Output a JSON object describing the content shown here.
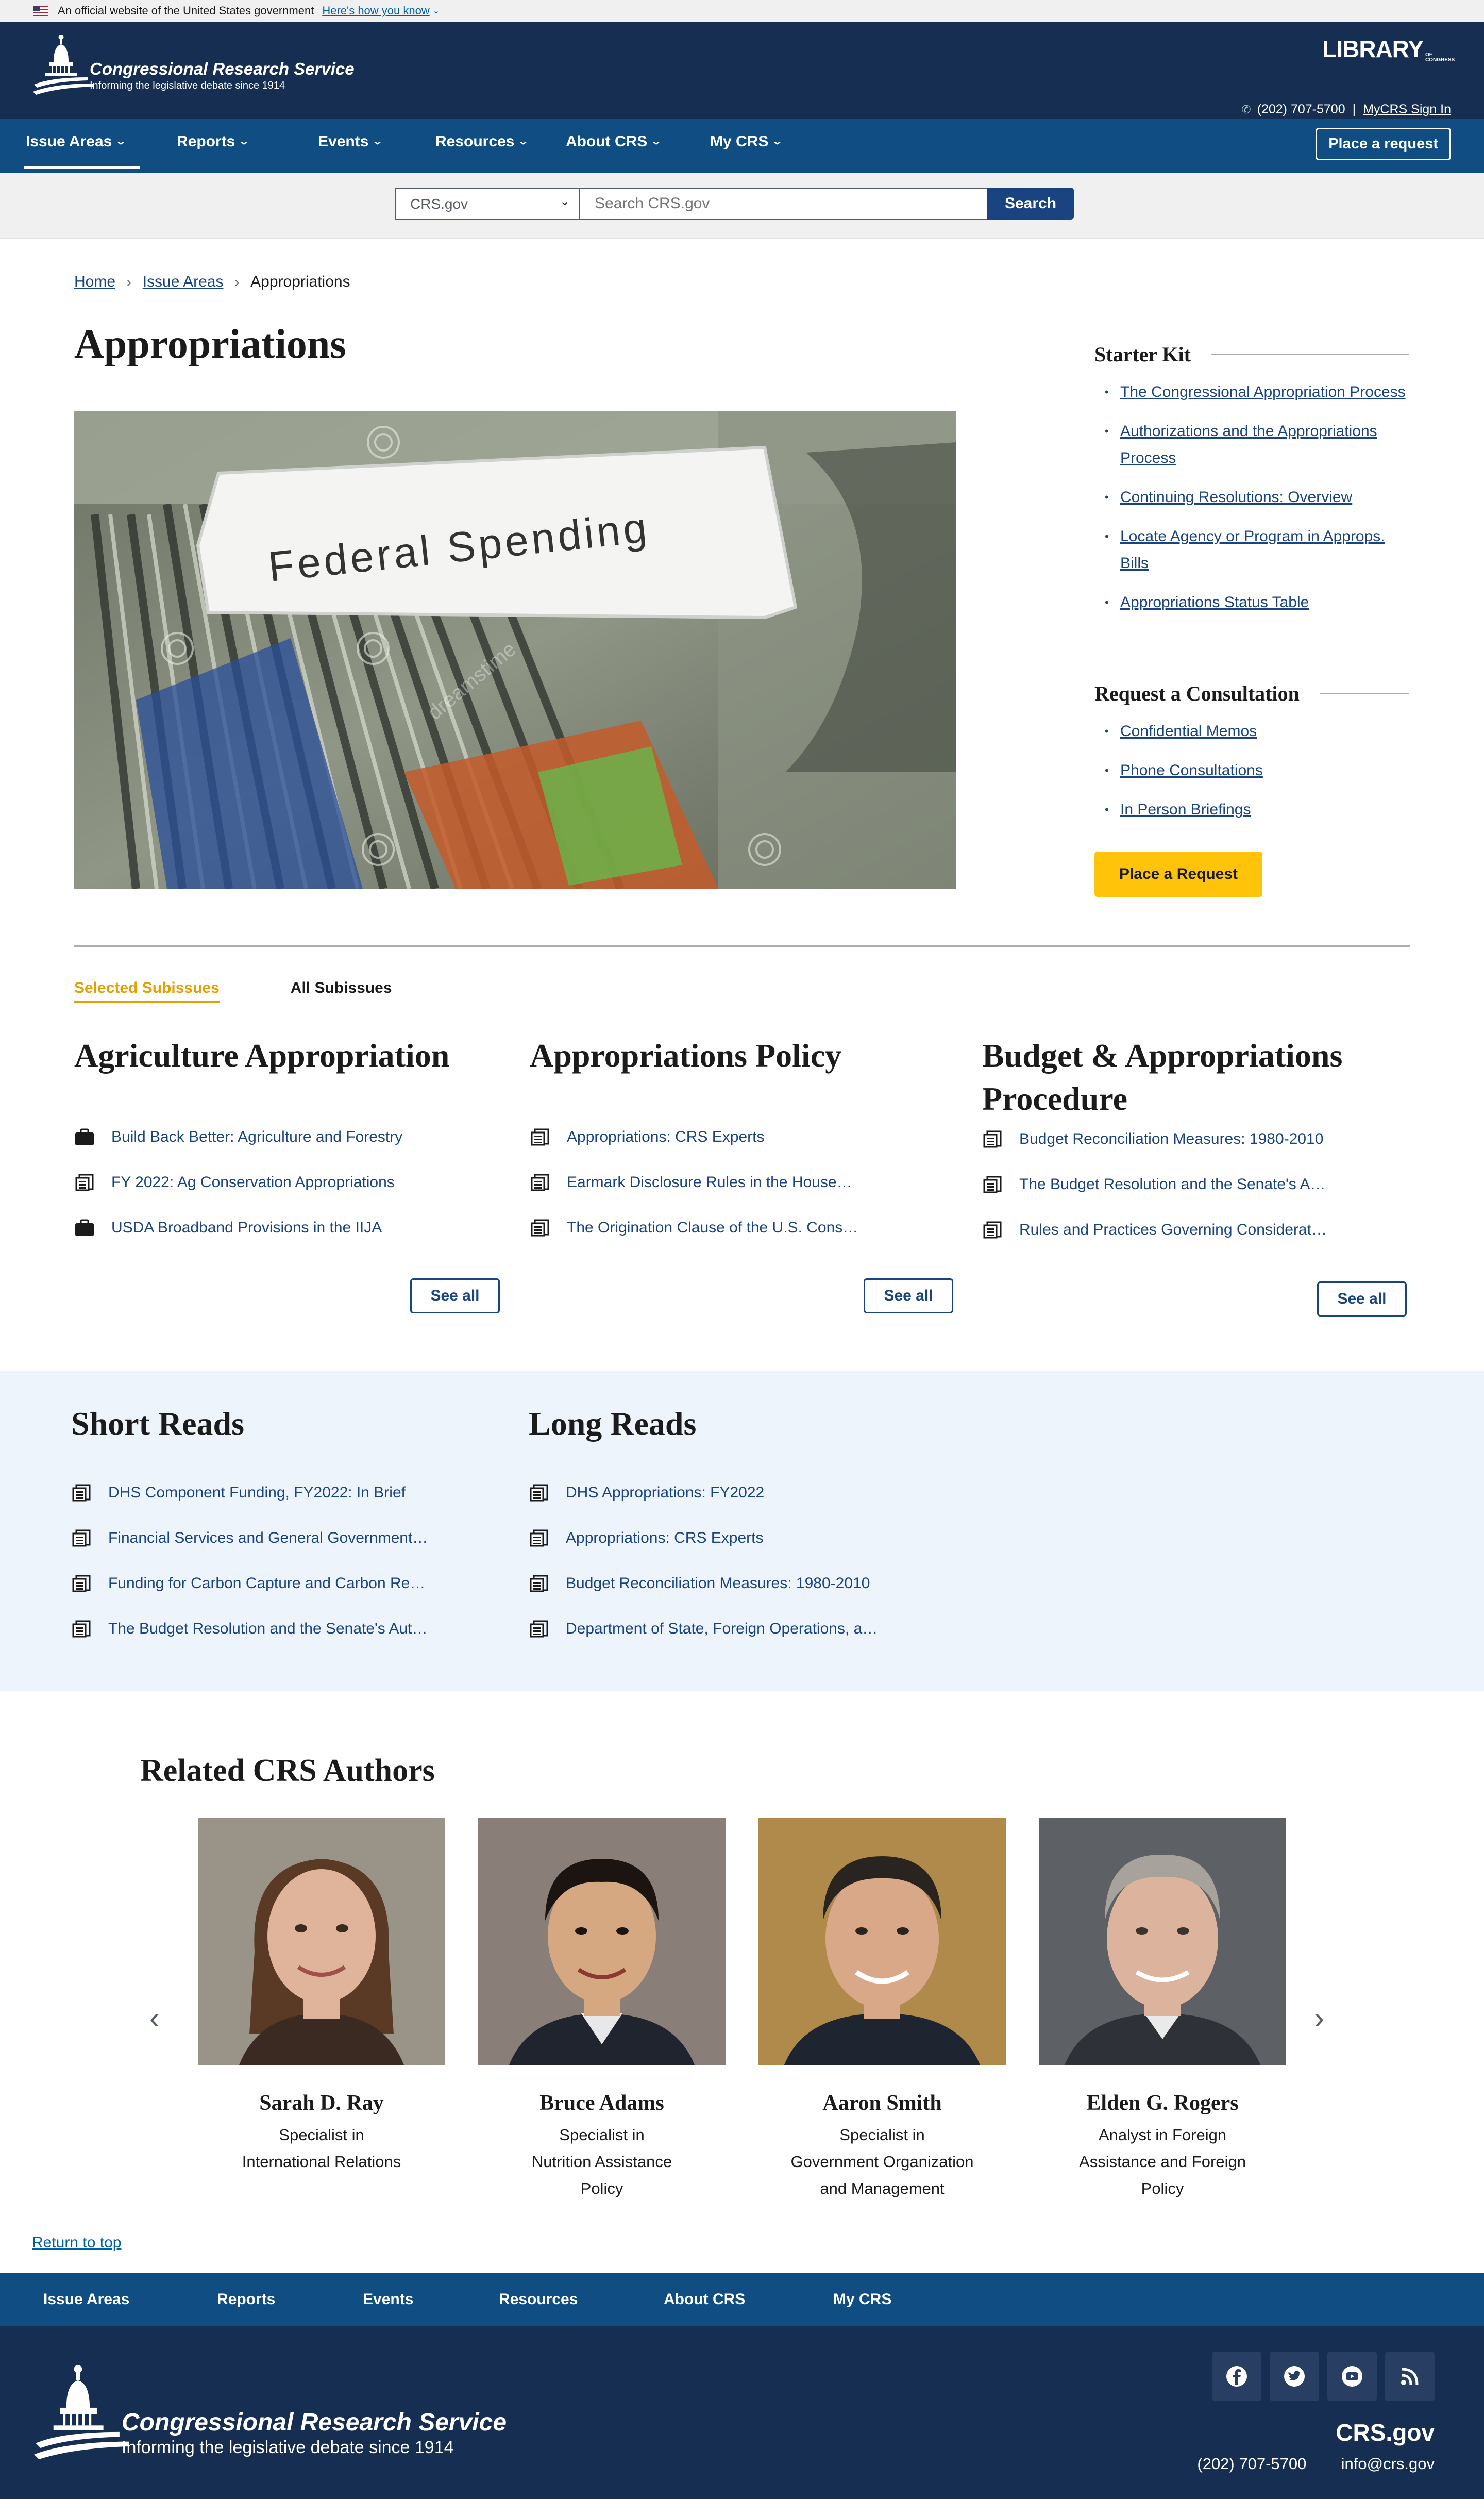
{
  "gov_banner": {
    "text": "An official website of the United States government",
    "link": "Here's how you know"
  },
  "header": {
    "brand_name": "Congressional Research Service",
    "brand_tagline": "Informing the legislative debate since 1914",
    "library_logo": "LIBRARY",
    "library_logo_small": "OF CONGRESS",
    "phone": "(202) 707-5700",
    "separator": "|",
    "sign_in": "MyCRS Sign In"
  },
  "nav": {
    "items": [
      "Issue Areas",
      "Reports",
      "Events",
      "Resources",
      "About CRS",
      "My CRS"
    ],
    "active": "Issue Areas",
    "request_button": "Place a request"
  },
  "search": {
    "scope": "CRS.gov",
    "placeholder": "Search CRS.gov",
    "button": "Search"
  },
  "breadcrumb": {
    "home": "Home",
    "issue_areas": "Issue Areas",
    "current": "Appropriations"
  },
  "page": {
    "title": "Appropriations",
    "hero_text": "Federal Spending",
    "hero_watermark": "dreamstime"
  },
  "starter_kit": {
    "title": "Starter Kit",
    "links": [
      "The Congressional Appropriation Process",
      "Authorizations and the Appropriations Process",
      "Continuing Resolutions: Overview",
      "Locate Agency or Program in Approps. Bills",
      "Appropriations Status Table"
    ]
  },
  "consultation": {
    "title": "Request a Consultation",
    "links": [
      "Confidential Memos",
      "Phone Consultations",
      "In Person Briefings"
    ],
    "button": "Place a Request"
  },
  "subissues": {
    "tabs": [
      "Selected Subissues",
      "All Subissues"
    ],
    "selected_tab": "Selected Subissues",
    "columns": [
      {
        "title": "Agriculture Appropriation",
        "items": [
          {
            "icon": "briefcase-icon",
            "text": "Build Back Better: Agriculture and Forestry"
          },
          {
            "icon": "document-icon",
            "text": "FY 2022: Ag Conservation Appropriations"
          },
          {
            "icon": "briefcase-icon",
            "text": "USDA Broadband Provisions in the IIJA"
          }
        ],
        "see_all": "See all"
      },
      {
        "title": "Appropriations Policy",
        "items": [
          {
            "icon": "document-icon",
            "text": "Appropriations: CRS Experts"
          },
          {
            "icon": "document-icon",
            "text": "Earmark Disclosure Rules in the House…"
          },
          {
            "icon": "document-icon",
            "text": "The Origination Clause of the U.S. Cons…"
          }
        ],
        "see_all": "See all"
      },
      {
        "title": "Budget & Appropriations Procedure",
        "items": [
          {
            "icon": "document-icon",
            "text": "Budget Reconciliation Measures: 1980-2010"
          },
          {
            "icon": "document-icon",
            "text": "The Budget Resolution and the Senate's A…"
          },
          {
            "icon": "document-icon",
            "text": "Rules and Practices Governing Considerat…"
          }
        ],
        "see_all": "See all"
      }
    ]
  },
  "reads": {
    "short": {
      "title": "Short Reads",
      "items": [
        "DHS Component Funding, FY2022: In Brief",
        "Financial Services and General Government…",
        "Funding for Carbon Capture and Carbon Re…",
        "The Budget Resolution and the Senate's Aut…"
      ]
    },
    "long": {
      "title": "Long Reads",
      "items": [
        "DHS Appropriations: FY2022",
        "Appropriations: CRS Experts",
        "Budget Reconciliation Measures: 1980-2010",
        "Department of State, Foreign Operations, a…"
      ]
    }
  },
  "authors": {
    "title": "Related CRS Authors",
    "people": [
      {
        "name": "Sarah D. Ray",
        "role": "Specialist in\nInternational Relations"
      },
      {
        "name": "Bruce Adams",
        "role": "Specialist in\nNutrition Assistance\nPolicy"
      },
      {
        "name": "Aaron Smith",
        "role": "Specialist in\nGovernment Organization\nand Management"
      },
      {
        "name": "Elden G. Rogers",
        "role": "Analyst in Foreign\nAssistance and Foreign\nPolicy"
      }
    ]
  },
  "return_to_top": "Return to top",
  "footer": {
    "nav": [
      "Issue Areas",
      "Reports",
      "Events",
      "Resources",
      "About CRS",
      "My CRS"
    ],
    "brand_name": "Congressional Research Service",
    "brand_tagline": "Informing the legislative debate since 1914",
    "site": "CRS.gov",
    "phone": "(202) 707-5700",
    "email": "info@crs.gov",
    "social": [
      "facebook-icon",
      "twitter-icon",
      "youtube-icon",
      "rss-icon"
    ]
  },
  "colors": {
    "navy": "#162e51",
    "nav_blue": "#0f4d83",
    "link": "#1a4480",
    "accent_yellow": "#ffc409",
    "tab_gold": "#e5a000",
    "reads_bg": "#eef4fb"
  }
}
